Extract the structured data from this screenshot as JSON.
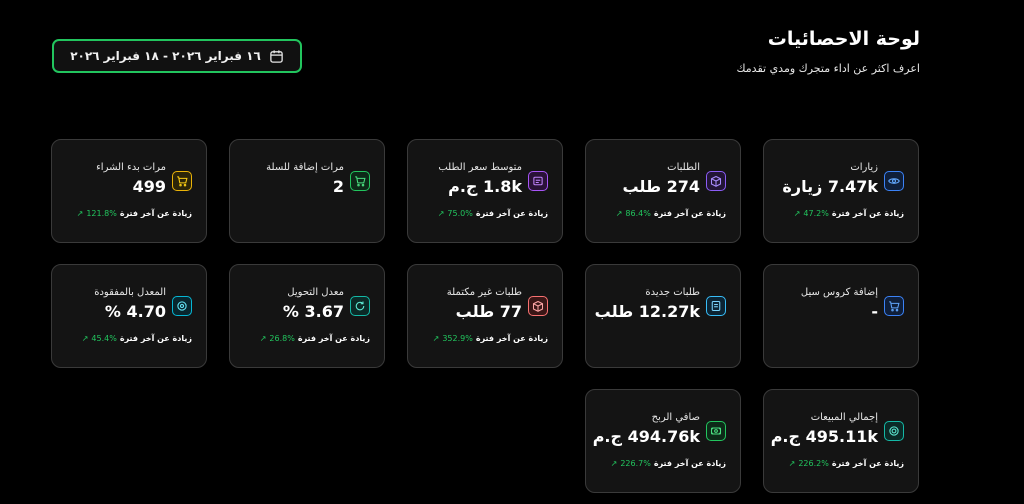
{
  "header": {
    "title": "لوحة الاحصائيات",
    "subtitle": "اعرف اكثر عن اداء متجرك ومدي تقدمك"
  },
  "date_range": {
    "label": "١٦ فبراير ٢٠٢٦ - ١٨ فبراير ٢٠٢٦"
  },
  "trend_label": "زيادة عن آخر فترة",
  "cards": {
    "visits": {
      "label": "زيارات",
      "value": "7.47k زيارة",
      "change": "47.2%",
      "icon": "eye-icon",
      "color": "#3b82f6"
    },
    "orders": {
      "label": "الطلبات",
      "value": "274 طلب",
      "change": "86.4%",
      "icon": "box-icon",
      "color": "#8b5cf6"
    },
    "avg_order": {
      "label": "متوسط سعر الطلب",
      "value": "1.8k ج.م",
      "change": "75.0%",
      "icon": "receipt-icon",
      "color": "#a855f7"
    },
    "add_to_cart": {
      "label": "مرات إضافة للسلة",
      "value": "2",
      "change": "",
      "icon": "cart-icon",
      "color": "#22c55e"
    },
    "checkout_start": {
      "label": "مرات بدء الشراء",
      "value": "499",
      "change": "121.8%",
      "icon": "cart-icon",
      "color": "#eab308"
    },
    "cross_sell": {
      "label": "إضافة كروس سيل",
      "value": "-",
      "change": "",
      "icon": "cart-icon",
      "color": "#3b82f6"
    },
    "new_orders": {
      "label": "طلبات جديدة",
      "value": "12.27k طلب",
      "change": "",
      "icon": "document-icon",
      "color": "#38bdf8"
    },
    "incomplete_orders": {
      "label": "طلبات غير مكتملة",
      "value": "77 طلب",
      "change": "352.9%",
      "icon": "box-icon",
      "color": "#f87171"
    },
    "conversion_rate": {
      "label": "معدل التحويل",
      "value": "3.67 %",
      "change": "26.8%",
      "icon": "refresh-icon",
      "color": "#14b8a6"
    },
    "lost_rate": {
      "label": "المعدل بالمفقودة",
      "value": "4.70 %",
      "change": "45.4%",
      "icon": "target-icon",
      "color": "#06b6d4"
    },
    "total_sales": {
      "label": "إجمالي المبيعات",
      "value": "495.11k ج.م",
      "change": "226.2%",
      "icon": "coin-icon",
      "color": "#14b8a6"
    },
    "net_profit": {
      "label": "صافي الربح",
      "value": "494.76k ج.م",
      "change": "226.7%",
      "icon": "money-icon",
      "color": "#22c55e"
    }
  }
}
